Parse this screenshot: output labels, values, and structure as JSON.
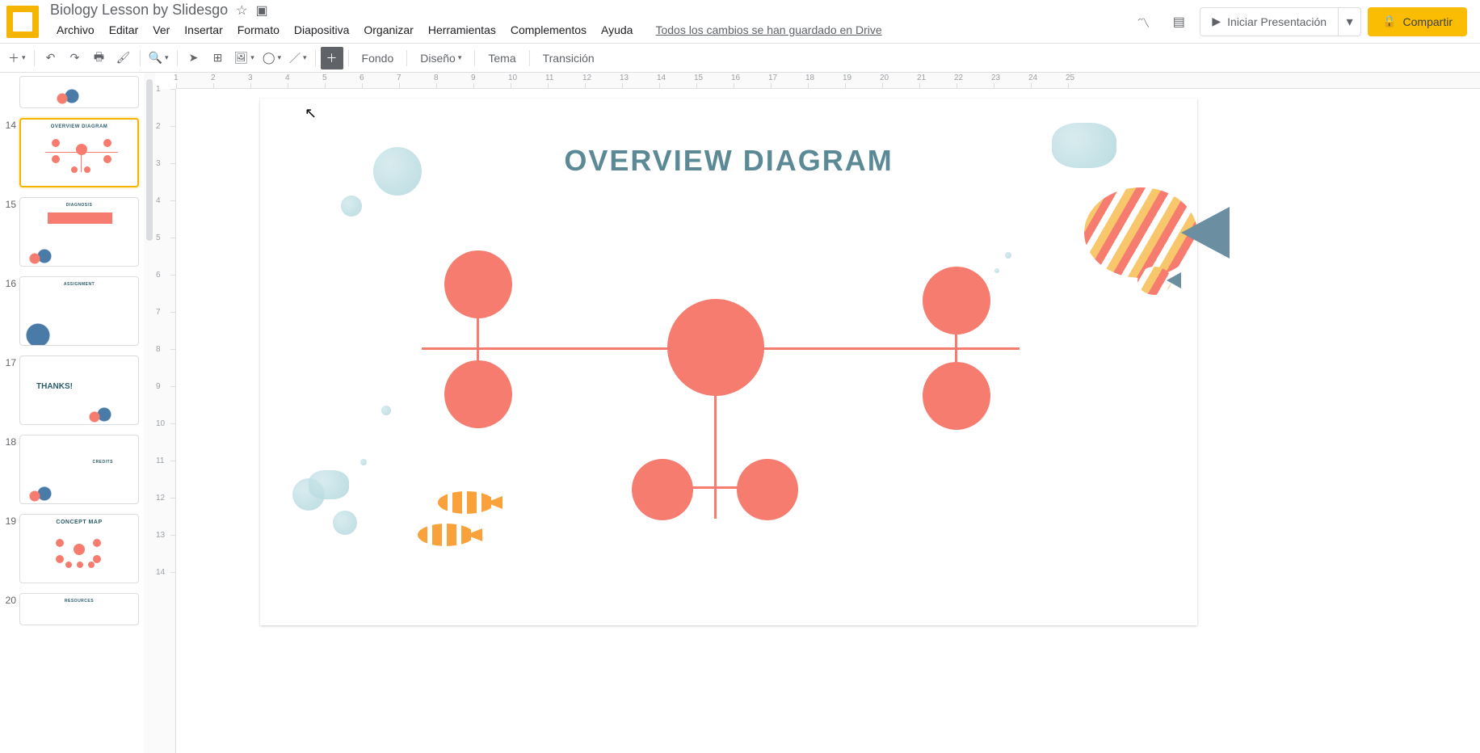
{
  "titlebar": {
    "doc_title": "Biology Lesson by Slidesgo"
  },
  "menubar": {
    "file": "Archivo",
    "edit": "Editar",
    "view": "Ver",
    "insert": "Insertar",
    "format": "Formato",
    "slide": "Diapositiva",
    "arrange": "Organizar",
    "tools": "Herramientas",
    "addons": "Complementos",
    "help": "Ayuda",
    "save_status": "Todos los cambios se han guardado en Drive"
  },
  "actions": {
    "present": "Iniciar Presentación",
    "share": "Compartir"
  },
  "toolbar": {
    "background": "Fondo",
    "design": "Diseño",
    "theme": "Tema",
    "transition": "Transición"
  },
  "ruler_h": [
    "1",
    "2",
    "3",
    "4",
    "5",
    "6",
    "7",
    "8",
    "9",
    "10",
    "11",
    "12",
    "13",
    "14",
    "15",
    "16",
    "17",
    "18",
    "19",
    "20",
    "21",
    "22",
    "23",
    "24",
    "25"
  ],
  "ruler_v": [
    "1",
    "2",
    "3",
    "4",
    "5",
    "6",
    "7",
    "8",
    "9",
    "10",
    "11",
    "12",
    "13",
    "14"
  ],
  "thumbs": [
    {
      "number": "",
      "title": ""
    },
    {
      "number": "14",
      "title": "OVERVIEW DIAGRAM",
      "selected": true
    },
    {
      "number": "15",
      "title": "DIAGNOSIS"
    },
    {
      "number": "16",
      "title": "ASSIGNMENT"
    },
    {
      "number": "17",
      "title": "THANKS!"
    },
    {
      "number": "18",
      "title": "CREDITS"
    },
    {
      "number": "19",
      "title": "CONCEPT MAP"
    },
    {
      "number": "20",
      "title": "RESOURCES"
    }
  ],
  "slide": {
    "title": "OVERVIEW DIAGRAM"
  }
}
